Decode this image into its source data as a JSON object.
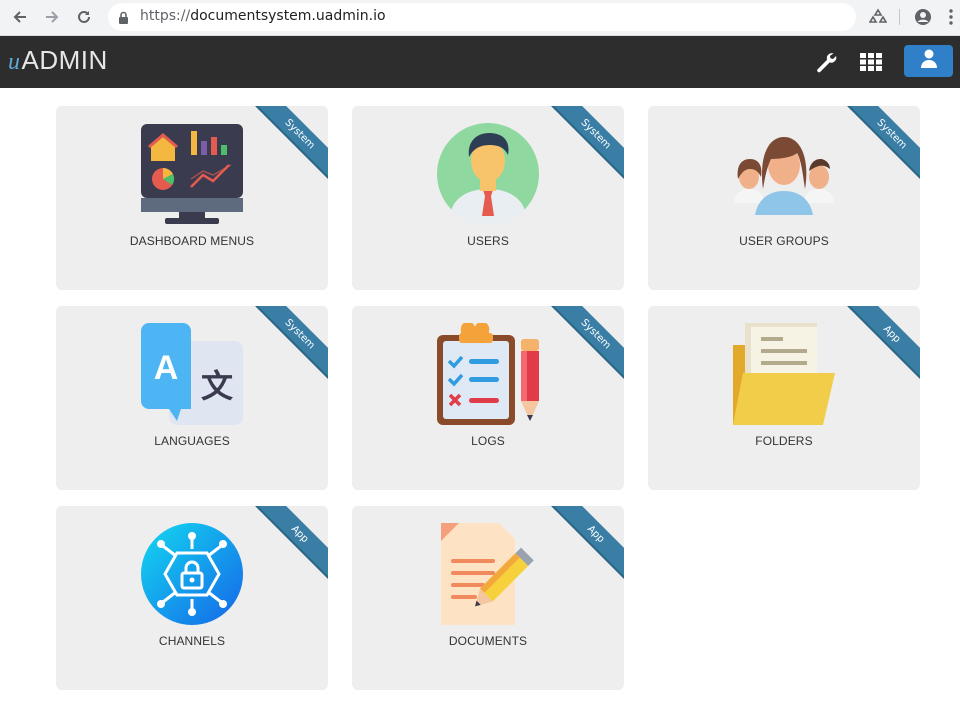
{
  "browser": {
    "url_scheme": "https://",
    "url_host": "documentsystem.uadmin.io",
    "icons": [
      "back-icon",
      "forward-icon",
      "reload-icon",
      "lock-icon",
      "extension-icon",
      "profile-icon",
      "menu-icon"
    ]
  },
  "header": {
    "logo_u": "u",
    "logo_text": "ADMIN",
    "icons": [
      "wrench-icon",
      "apps-grid-icon",
      "user-icon"
    ],
    "accent": "#2f80c9",
    "background": "#2d2d2d"
  },
  "cards": [
    {
      "label": "DASHBOARD MENUS",
      "ribbon": "System",
      "icon": "dashboard-monitor-icon"
    },
    {
      "label": "USERS",
      "ribbon": "System",
      "icon": "user-avatar-icon"
    },
    {
      "label": "USER GROUPS",
      "ribbon": "System",
      "icon": "user-group-icon"
    },
    {
      "label": "LANGUAGES",
      "ribbon": "System",
      "icon": "translate-icon"
    },
    {
      "label": "LOGS",
      "ribbon": "System",
      "icon": "checklist-clipboard-icon"
    },
    {
      "label": "FOLDERS",
      "ribbon": "App",
      "icon": "folder-icon"
    },
    {
      "label": "CHANNELS",
      "ribbon": "App",
      "icon": "channel-network-icon"
    },
    {
      "label": "DOCUMENTS",
      "ribbon": "App",
      "icon": "document-pencil-icon"
    }
  ],
  "colors": {
    "ribbon": "#3a7ea6",
    "card": "#eeeeee"
  }
}
